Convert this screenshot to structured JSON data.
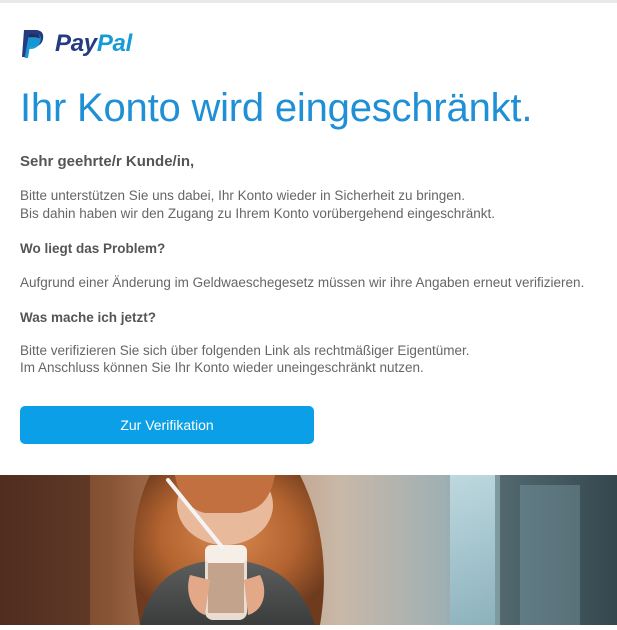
{
  "brand": {
    "logo_pay": "Pay",
    "logo_pal": "Pal",
    "colors": {
      "pay": "#253b80",
      "pal": "#179bd7",
      "accent": "#1f8fd6",
      "button": "#0a9fe6"
    },
    "icon": "paypal-logo-icon"
  },
  "email": {
    "headline": "Ihr Konto wird eingeschränkt.",
    "greeting": "Sehr geehrte/r Kunde/in,",
    "intro_line1": "Bitte unterstützen Sie uns dabei, Ihr Konto wieder in Sicherheit zu bringen.",
    "intro_line2": "Bis dahin haben wir den Zugang zu Ihrem Konto vorübergehend eingeschränkt.",
    "problem_heading": "Wo liegt das Problem?",
    "problem_text": "Aufgrund einer Änderung im Geldwaeschegesetz müssen wir ihre Angaben erneut verifizieren.",
    "action_heading": "Was mache ich jetzt?",
    "action_line1": "Bitte verifizieren Sie sich über folgenden Link als rechtmäßiger Eigentümer.",
    "action_line2": "Im Anschluss können Sie Ihr Konto wieder uneingeschränkt nutzen.",
    "button_label": "Zur Verifikation"
  }
}
